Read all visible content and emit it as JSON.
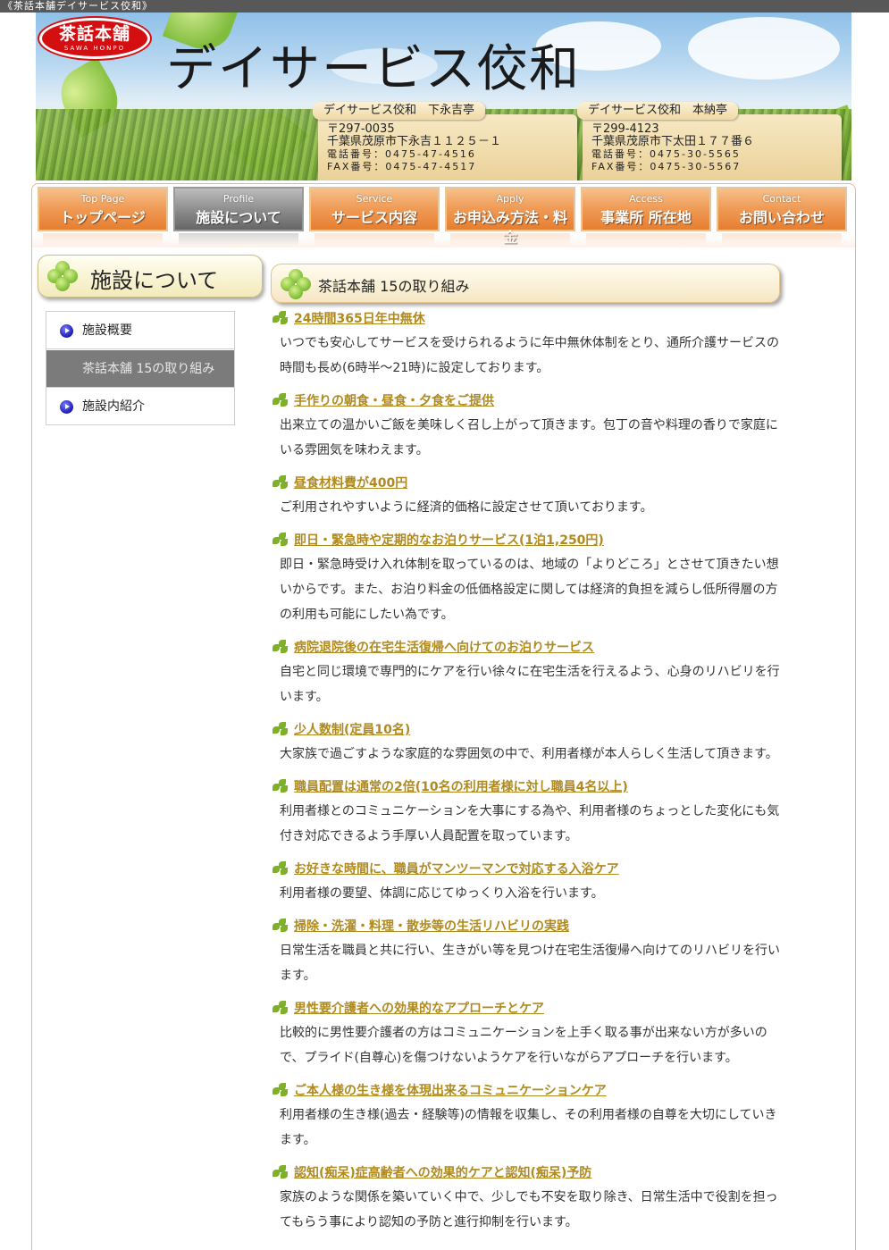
{
  "topbar": {
    "text": "《茶話本舗デイサービス佼和》"
  },
  "header": {
    "logo_main": "茶話本舗",
    "logo_sub": "SAWA HONPO",
    "site_title": "デイサービス佼和",
    "offices": [
      {
        "name": "デイサービス佼和　下永吉亭",
        "postal": "〒297-0035",
        "address": "千葉県茂原市下永吉１１２５－１",
        "tel": "電話番号：0475-47-4516",
        "fax": "FAX番号：0475-47-4517"
      },
      {
        "name": "デイサービス佼和　本納亭",
        "postal": "〒299-4123",
        "address": "千葉県茂原市下太田１７７番６",
        "tel": "電話番号：0475-30-5565",
        "fax": "FAX番号：0475-30-5567"
      }
    ]
  },
  "nav": [
    {
      "en": "Top Page",
      "ja": "トップページ"
    },
    {
      "en": "Profile",
      "ja": "施設について"
    },
    {
      "en": "Service",
      "ja": "サービス内容"
    },
    {
      "en": "Apply",
      "ja": "お申込み方法・料金"
    },
    {
      "en": "Access",
      "ja": "事業所 所在地"
    },
    {
      "en": "Contact",
      "ja": "お問い合わせ"
    }
  ],
  "sidebar": {
    "title": "施設について",
    "items": [
      {
        "label": "施設概要"
      },
      {
        "label": "茶話本舗 15の取り組み"
      },
      {
        "label": "施設内紹介"
      }
    ]
  },
  "main": {
    "title": "茶話本舗 15の取り組み",
    "entries": [
      {
        "heading": "24時間365日年中無休",
        "text": "いつでも安心してサービスを受けられるように年中無休体制をとり、通所介護サービスの時間も長め(6時半～21時)に設定しております。"
      },
      {
        "heading": "手作りの朝食・昼食・夕食をご提供",
        "text": "出来立ての温かいご飯を美味しく召し上がって頂きます。包丁の音や料理の香りで家庭にいる雰囲気を味わえます。"
      },
      {
        "heading": "昼食材料費が400円",
        "text": "ご利用されやすいように経済的価格に設定させて頂いております。"
      },
      {
        "heading": "即日・緊急時や定期的なお泊りサービス(1泊1,250円)",
        "text": "即日・緊急時受け入れ体制を取っているのは、地域の「よりどころ」とさせて頂きたい想いからです。また、お泊り料金の低価格設定に関しては経済的負担を減らし低所得層の方の利用も可能にしたい為です。"
      },
      {
        "heading": "病院退院後の在宅生活復帰へ向けてのお泊りサービス",
        "text": "自宅と同じ環境で専門的にケアを行い徐々に在宅生活を行えるよう、心身のリハビリを行います。"
      },
      {
        "heading": "少人数制(定員10名)",
        "text": "大家族で過ごすような家庭的な雰囲気の中で、利用者様が本人らしく生活して頂きます。"
      },
      {
        "heading": "職員配置は通常の2倍(10名の利用者様に対し職員4名以上)",
        "text": "利用者様とのコミュニケーションを大事にする為や、利用者様のちょっとした変化にも気付き対応できるよう手厚い人員配置を取っています。"
      },
      {
        "heading": "お好きな時間に、職員がマンツーマンで対応する入浴ケア",
        "text": "利用者様の要望、体調に応じてゆっくり入浴を行います。"
      },
      {
        "heading": "掃除・洗濯・料理・散歩等の生活リハビリの実践",
        "text": "日常生活を職員と共に行い、生きがい等を見つけ在宅生活復帰へ向けてのリハビリを行います。"
      },
      {
        "heading": "男性要介護者への効果的なアプローチとケア",
        "text": "比較的に男性要介護者の方はコミュニケーションを上手く取る事が出来ない方が多いので、プライド(自尊心)を傷つけないようケアを行いながらアプローチを行います。"
      },
      {
        "heading": "ご本人様の生き様を体現出来るコミュニケーションケア",
        "text": "利用者様の生き様(過去・経験等)の情報を収集し、その利用者様の自尊を大切にしていきます。"
      },
      {
        "heading": "認知(痴呆)症高齢者への効果的ケアと認知(痴呆)予防",
        "text": "家族のような関係を築いていく中で、少しでも不安を取り除き、日常生活中で役割を担ってもらう事により認知の予防と進行抑制を行います。"
      }
    ]
  }
}
